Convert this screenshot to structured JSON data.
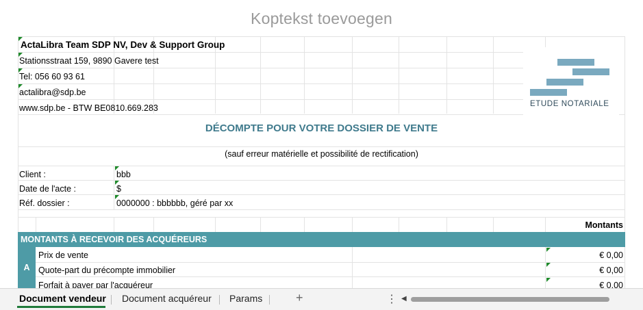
{
  "header": {
    "text": "Koptekst toevoegen"
  },
  "company": {
    "name": "ActaLibra Team SDP NV, Dev & Support Group",
    "address": "Stationsstraat 159, 9890 Gavere test",
    "tel": "Tel: 056 60 93 61",
    "email": "actalibra@sdp.be",
    "web": "www.sdp.be  - BTW BE0810.669.283"
  },
  "logo": {
    "text": "ETUDE NOTARIALE"
  },
  "document": {
    "title": "DÉCOMPTE POUR VOTRE DOSSIER DE VENTE",
    "subtitle": "(sauf erreur matérielle et possibilité de rectification)"
  },
  "info": [
    {
      "label": "Client :",
      "value": "bbb"
    },
    {
      "label": "Date de l'acte :",
      "value": "$"
    },
    {
      "label": "Réf. dossier :",
      "value": "0000000 : bbbbbb, géré par xx"
    }
  ],
  "amounts_header": "Montants",
  "section": {
    "title": "MONTANTS À RECEVOIR DES ACQUÉREURS",
    "letter": "A",
    "rows": [
      {
        "label": "Prix de vente",
        "amount": "€ 0,00"
      },
      {
        "label": "Quote-part du précompte immobilier",
        "amount": "€ 0,00"
      },
      {
        "label": "Forfait à payer par l'acquéreur",
        "amount": "€ 0,00"
      }
    ]
  },
  "tabs": [
    {
      "label": "Document vendeur",
      "active": true
    },
    {
      "label": "Document acquéreur",
      "active": false
    },
    {
      "label": "Params",
      "active": false
    }
  ],
  "icons": {
    "add_sheet": "plus-icon",
    "more": "vertical-ellipsis-icon",
    "scroll_left": "triangle-left-icon"
  },
  "colors": {
    "section_bg": "#4e9ba6",
    "title": "#3f7a8c",
    "comment_marker": "#1f8a2b",
    "active_tab_underline": "#1f7a3a"
  }
}
